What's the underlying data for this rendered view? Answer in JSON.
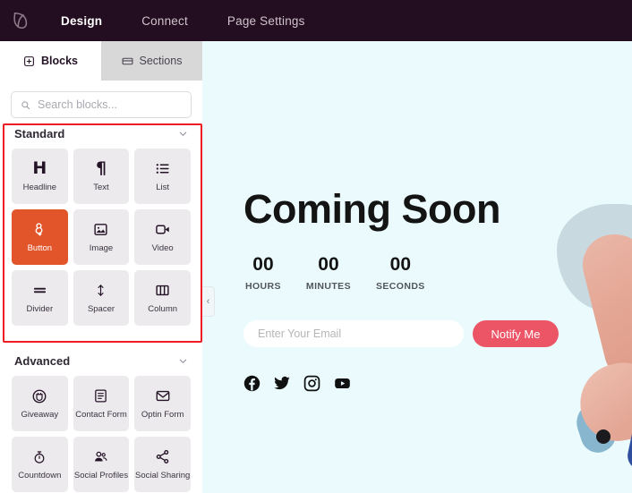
{
  "topbar": {
    "logo_icon": "leaf-logo-icon",
    "nav": [
      {
        "label": "Design",
        "active": true
      },
      {
        "label": "Connect",
        "active": false
      },
      {
        "label": "Page Settings",
        "active": false
      }
    ],
    "bg_color": "#230D20"
  },
  "tabs": [
    {
      "label": "Blocks",
      "icon": "blocks-icon",
      "active": true
    },
    {
      "label": "Sections",
      "icon": "sections-icon",
      "active": false
    }
  ],
  "search": {
    "placeholder": "Search blocks...",
    "value": "",
    "icon": "search-icon"
  },
  "highlight": {
    "color": "#ee1d24",
    "target": "standard-blocks-group"
  },
  "collapse_handle": {
    "icon": "chevron-left-icon",
    "label": "‹"
  },
  "groups": [
    {
      "title": "Standard",
      "collapse_icon": "chevron-down-icon",
      "blocks": [
        {
          "label": "Headline",
          "icon": "headline-icon",
          "selected": false
        },
        {
          "label": "Text",
          "icon": "paragraph-icon",
          "selected": false
        },
        {
          "label": "List",
          "icon": "list-icon",
          "selected": false
        },
        {
          "label": "Button",
          "icon": "button-cursor-icon",
          "selected": true
        },
        {
          "label": "Image",
          "icon": "image-icon",
          "selected": false
        },
        {
          "label": "Video",
          "icon": "video-camera-icon",
          "selected": false
        },
        {
          "label": "Divider",
          "icon": "divider-icon",
          "selected": false
        },
        {
          "label": "Spacer",
          "icon": "spacer-arrows-icon",
          "selected": false
        },
        {
          "label": "Column",
          "icon": "columns-icon",
          "selected": false
        }
      ]
    },
    {
      "title": "Advanced",
      "collapse_icon": "chevron-down-icon",
      "blocks": [
        {
          "label": "Giveaway",
          "icon": "giveaway-icon",
          "selected": false
        },
        {
          "label": "Contact Form",
          "icon": "contact-form-icon",
          "selected": false
        },
        {
          "label": "Optin Form",
          "icon": "envelope-icon",
          "selected": false
        },
        {
          "label": "Countdown",
          "icon": "stopwatch-icon",
          "selected": false
        },
        {
          "label": "Social Profiles",
          "icon": "social-profiles-icon",
          "selected": false
        },
        {
          "label": "Social Sharing",
          "icon": "share-icon",
          "selected": false
        }
      ]
    }
  ],
  "preview": {
    "bg_color": "#ebfbfd",
    "headline": "Coming Soon",
    "countdown": [
      {
        "value": "00",
        "unit": "HOURS"
      },
      {
        "value": "00",
        "unit": "MINUTES"
      },
      {
        "value": "00",
        "unit": "SECONDS"
      }
    ],
    "email_field": {
      "placeholder": "Enter Your Email",
      "value": ""
    },
    "notify_button": {
      "label": "Notify Me",
      "color": "#ec5566"
    },
    "social_links": [
      {
        "name": "facebook-icon"
      },
      {
        "name": "twitter-icon"
      },
      {
        "name": "instagram-icon"
      },
      {
        "name": "youtube-icon"
      }
    ]
  }
}
